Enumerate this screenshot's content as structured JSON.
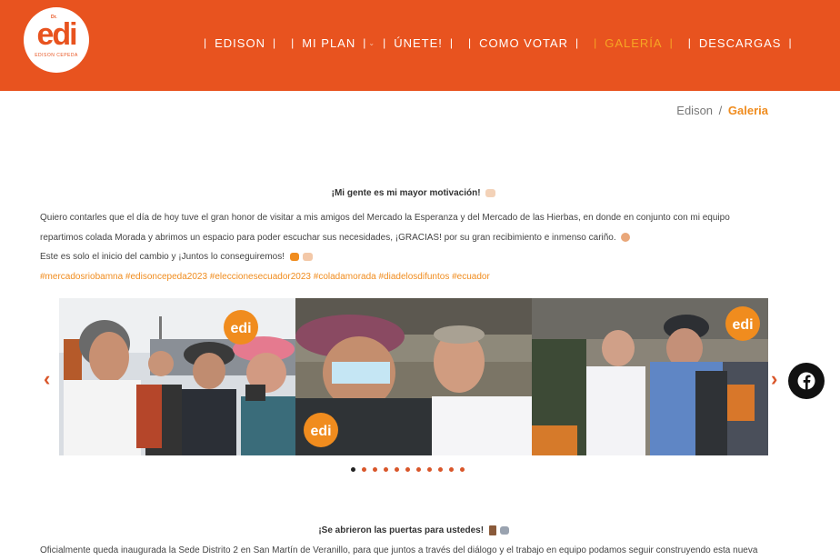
{
  "brand": {
    "logo_text": "edi",
    "logo_prefix": "Dr.",
    "logo_subtitle": "EDISON CEPEDA",
    "color": "#e8531f"
  },
  "nav": {
    "items": [
      {
        "label": "EDISON",
        "active": false
      },
      {
        "label": "MI PLAN",
        "active": false,
        "has_dropdown": true
      },
      {
        "label": "ÚNETE!",
        "active": false
      },
      {
        "label": "COMO VOTAR",
        "active": false
      },
      {
        "label": "GALERÍA",
        "active": true
      },
      {
        "label": "DESCARGAS",
        "active": false
      }
    ],
    "separator": "|",
    "dropdown_caret": "⌄"
  },
  "breadcrumb": {
    "home": "Edison",
    "separator": "/",
    "current": "Galeria"
  },
  "post1": {
    "title": "¡Mi gente es mi mayor motivación!",
    "line1": "Quiero contarles que el día de hoy tuve el gran honor de visitar a mis amigos del Mercado la Esperanza y del Mercado de las Hierbas, en donde en conjunto con mi equipo",
    "line2": "repartimos colada Morada y abrimos un espacio para poder escuchar sus necesidades, ¡GRACIAS! por su gran recibimiento e inmenso cariño.",
    "line3": "Este es solo el inicio del cambio y ¡Juntos lo conseguiremos!",
    "hashtags": "#mercadosriobamna #edisoncepeda2023 #eleccionesecuador2023 #coladamorada #diadelosdifuntos #ecuador"
  },
  "carousel": {
    "prev_icon": "chevron-left-icon",
    "next_icon": "chevron-right-icon",
    "prev_glyph": "‹",
    "next_glyph": "›",
    "badge_text": "edi",
    "slide_count": 11,
    "active_index": 0
  },
  "post2": {
    "title": "¡Se abrieron las puertas para ustedes!",
    "line1": "Oficialmente queda inaugurada la Sede Distrito 2 en San Martín de Veranillo, para que juntos a través del diálogo y el trabajo en equipo podamos seguir construyendo esta nueva"
  },
  "social": {
    "facebook_icon": "facebook-icon"
  },
  "colors": {
    "accent": "#f08c1e",
    "header_bg": "#e8531f",
    "nav_active": "#f6a623"
  }
}
